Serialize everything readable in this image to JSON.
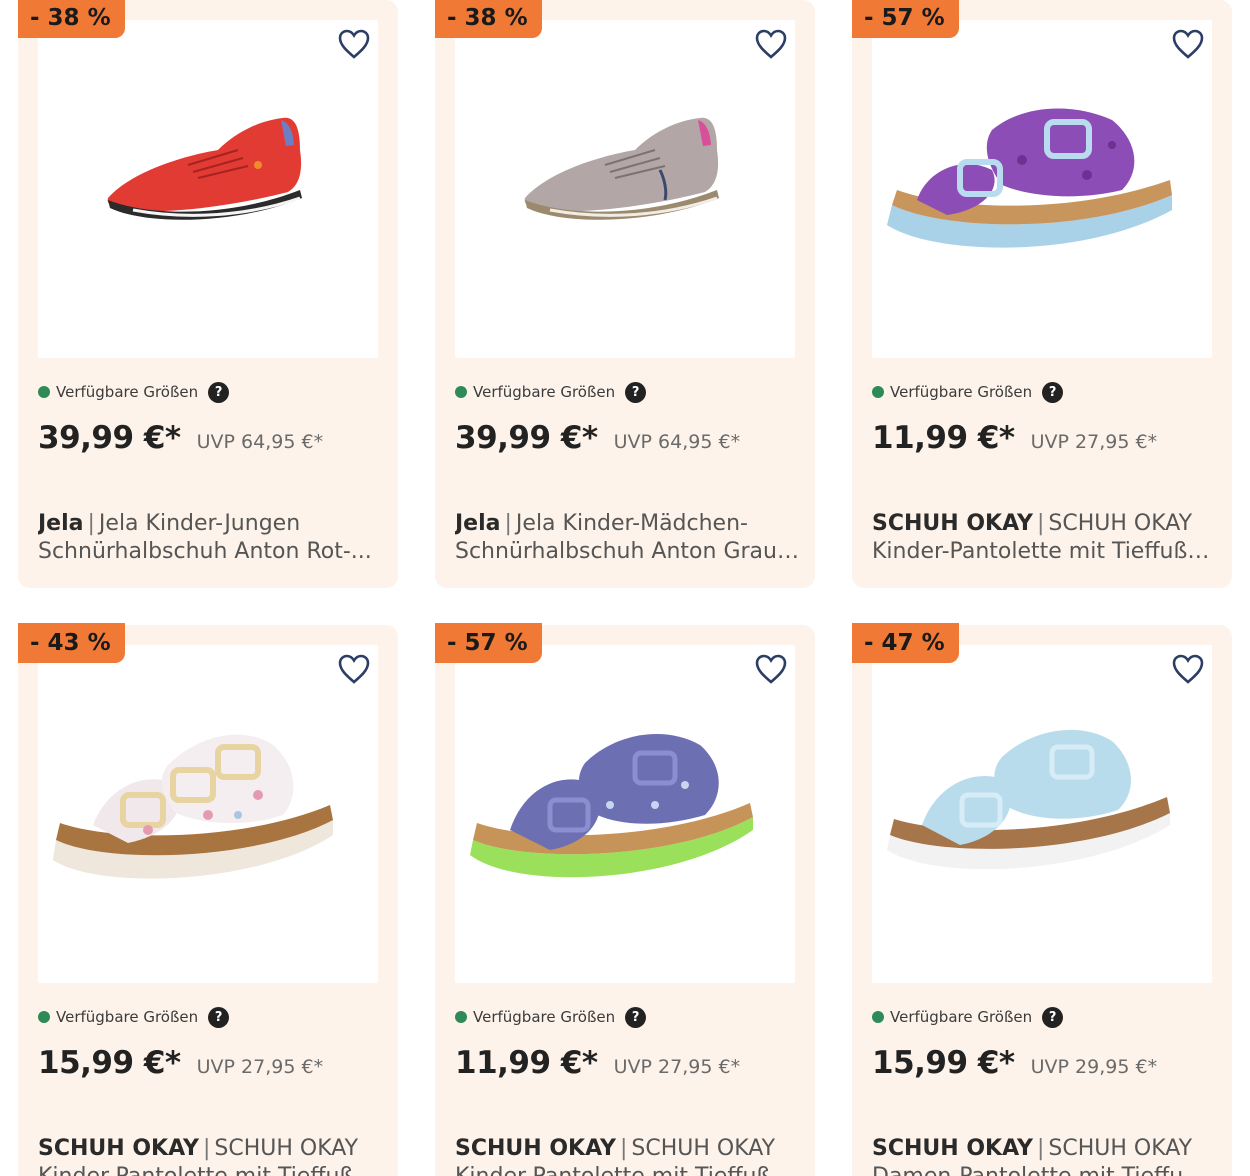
{
  "products": [
    {
      "discount": "- 38 %",
      "image_icon": "red-sneaker-image",
      "sizes_label": "Verfügbare Größen",
      "help": "?",
      "price": "39,99 €*",
      "uvp": "UVP 64,95 €*",
      "brand": "Jela",
      "sep": "|",
      "name_line1": "Jela Kinder-Jungen",
      "name_line2": "Schnürhalbschuh Anton Rot-..."
    },
    {
      "discount": "- 38 %",
      "image_icon": "grey-sneaker-image",
      "sizes_label": "Verfügbare Größen",
      "help": "?",
      "price": "39,99 €*",
      "uvp": "UVP 64,95 €*",
      "brand": "Jela",
      "sep": "|",
      "name_line1": "Jela Kinder-Mädchen-",
      "name_line2": "Schnürhalbschuh Anton Grau-..."
    },
    {
      "discount": "- 57 %",
      "image_icon": "purple-sandal-image",
      "sizes_label": "Verfügbare Größen",
      "help": "?",
      "price": "11,99 €*",
      "uvp": "UVP 27,95 €*",
      "brand": "SCHUH OKAY",
      "sep": "|",
      "name_line1": "SCHUH OKAY",
      "name_line2": "Kinder-Pantolette mit Tieffußbet..."
    },
    {
      "discount": "- 43 %",
      "image_icon": "floral-sandal-image",
      "sizes_label": "Verfügbare Größen",
      "help": "?",
      "price": "15,99 €*",
      "uvp": "UVP 27,95 €*",
      "brand": "SCHUH OKAY",
      "sep": "|",
      "name_line1": "SCHUH OKAY",
      "name_line2": "Kinder-Pantolette mit Tieffußbet..."
    },
    {
      "discount": "- 57 %",
      "image_icon": "blue-sandal-image",
      "sizes_label": "Verfügbare Größen",
      "help": "?",
      "price": "11,99 €*",
      "uvp": "UVP 27,95 €*",
      "brand": "SCHUH OKAY",
      "sep": "|",
      "name_line1": "SCHUH OKAY",
      "name_line2": "Kinder-Pantolette mit Tieffußbet..."
    },
    {
      "discount": "- 47 %",
      "image_icon": "light-blue-sandal-image",
      "sizes_label": "Verfügbare Größen",
      "help": "?",
      "price": "15,99 €*",
      "uvp": "UVP 29,95 €*",
      "brand": "SCHUH OKAY",
      "sep": "|",
      "name_line1": "SCHUH OKAY",
      "name_line2": "Damen-Pantolette mit Tieffußbe..."
    }
  ],
  "colors": {
    "card_bg": "#fdf3ea",
    "badge": "#f07a35",
    "available_dot": "#2e8b57"
  }
}
